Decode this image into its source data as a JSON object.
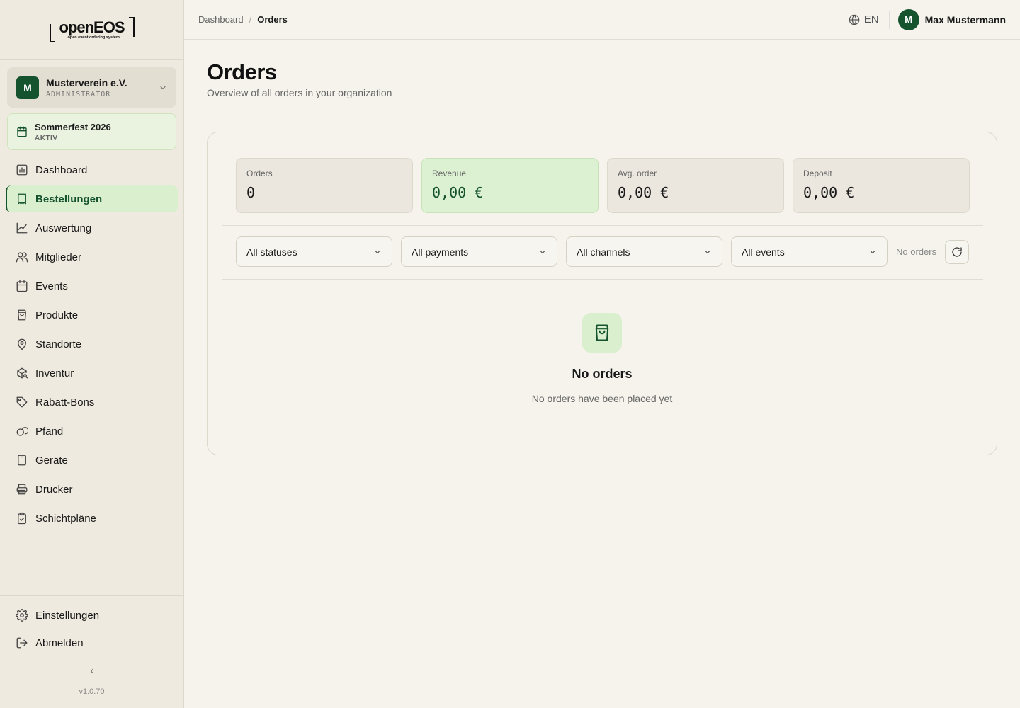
{
  "logo": {
    "word": "openEOS",
    "tagline": "open event ordering system"
  },
  "org": {
    "initial": "M",
    "name": "Musterverein e.V.",
    "role": "ADMINISTRATOR"
  },
  "event": {
    "name": "Sommerfest 2026",
    "status": "AKTIV"
  },
  "nav": {
    "items": [
      {
        "label": "Dashboard",
        "icon": "chart-bar-icon"
      },
      {
        "label": "Bestellungen",
        "icon": "receipt-icon",
        "active": true
      },
      {
        "label": "Auswertung",
        "icon": "line-chart-icon"
      },
      {
        "label": "Mitglieder",
        "icon": "users-icon"
      },
      {
        "label": "Events",
        "icon": "calendar-icon"
      },
      {
        "label": "Produkte",
        "icon": "shopping-bag-icon"
      },
      {
        "label": "Standorte",
        "icon": "map-pin-icon"
      },
      {
        "label": "Inventur",
        "icon": "package-search-icon"
      },
      {
        "label": "Rabatt-Bons",
        "icon": "tag-icon"
      },
      {
        "label": "Pfand",
        "icon": "coins-icon"
      },
      {
        "label": "Geräte",
        "icon": "tablet-icon"
      },
      {
        "label": "Drucker",
        "icon": "printer-icon"
      },
      {
        "label": "Schichtpläne",
        "icon": "clipboard-check-icon"
      }
    ],
    "settings": "Einstellungen",
    "logout": "Abmelden"
  },
  "version": "v1.0.70",
  "breadcrumb": {
    "parent": "Dashboard",
    "separator": "/",
    "current": "Orders"
  },
  "topbar": {
    "language": "EN",
    "user_initial": "M",
    "user_name": "Max Mustermann"
  },
  "page": {
    "title": "Orders",
    "subtitle": "Overview of all orders in your organization"
  },
  "stats": [
    {
      "label": "Orders",
      "value": "0"
    },
    {
      "label": "Revenue",
      "value": "0,00 €"
    },
    {
      "label": "Avg. order",
      "value": "0,00 €"
    },
    {
      "label": "Deposit",
      "value": "0,00 €"
    }
  ],
  "filters": {
    "status": "All statuses",
    "payment": "All payments",
    "channel": "All channels",
    "event": "All events",
    "count": "No orders"
  },
  "empty": {
    "title": "No orders",
    "subtitle": "No orders have been placed yet"
  },
  "colors": {
    "accent": "#14532d",
    "active_bg": "#d9efcd",
    "background": "#f5f3ec",
    "sidebar": "#efeadf"
  }
}
